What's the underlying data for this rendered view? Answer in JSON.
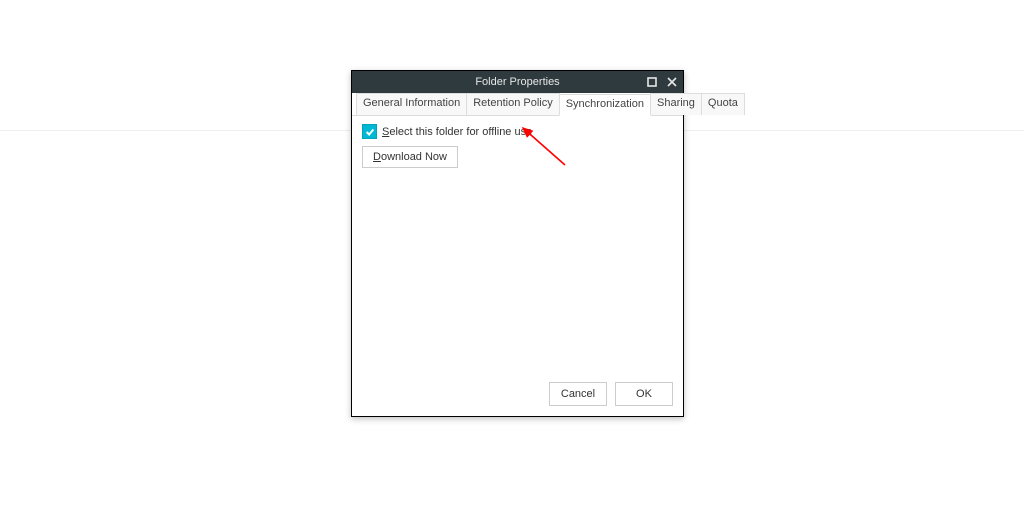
{
  "dialog": {
    "title": "Folder Properties",
    "tabs": [
      {
        "label": "General Information"
      },
      {
        "label": "Retention Policy"
      },
      {
        "label": "Synchronization"
      },
      {
        "label": "Sharing"
      },
      {
        "label": "Quota"
      }
    ],
    "active_tab_index": 2,
    "sync": {
      "checkbox_label_prefix": "S",
      "checkbox_label_rest": "elect this folder for offline use",
      "checked": true,
      "download_prefix": "D",
      "download_rest": "ownload Now"
    },
    "footer": {
      "cancel": "Cancel",
      "ok": "OK"
    }
  }
}
